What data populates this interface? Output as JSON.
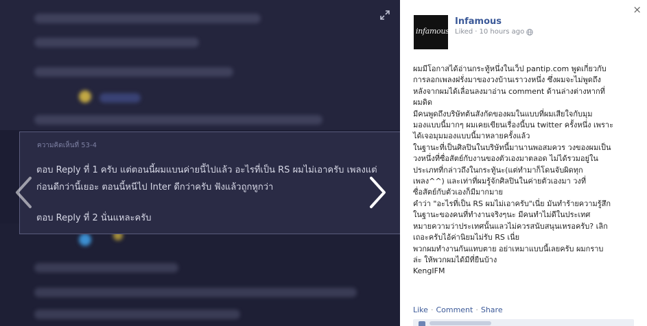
{
  "photo": {
    "card": {
      "header": "ความคิดเห็นที่ 53-4",
      "line1": "ตอบ Reply ที่ 1 ครับ แต่ตอนนี้ผมแบนค่ายนี้ไปแล้ว อะไรที่เป็น RS ผมไม่เอาครับ เพลงแต่",
      "line2": "ก่อนดีกว่านี้เยอะ ตอนนี้หนีไป Inter ดีกว่าครับ ฟังแล้วถูกหูกว่า",
      "line3": "ตอบ Reply ที่ 2 นั่นแหละครับ"
    },
    "prev_icon": "chevron-left-icon",
    "next_icon": "chevron-right-icon",
    "expand_icon": "expand-icon"
  },
  "panel": {
    "close_label": "×",
    "avatar_text": "infamous",
    "page_name": "Infamous",
    "liked": "Liked",
    "time": "10 hours ago",
    "post_lines": [
      "ผมมีโอกาสได้อ่านกระทู้หนึ่งในเว็ป pantip.com พูดเกี่ยวกับ",
      "การลอกเพลงฝรั่งมาของวงบ้านเราวงหนึ่ง ซึ่งผมจะไม่พูดถึง",
      "หลังจากผมได้เลื่อนลงมาอ่าน comment ด้านล่างต่างหากที่",
      "ผมดิด",
      "มีคนพูดถึงบริษัทต้นสังกัดของผมในแบบที่ผมเสียใจกับมุม",
      "มองแบบนี้มากๆ ผมเคยเขียนเรื่องนี้บน twitter ครั้งหนึ่ง เพราะ",
      "ได้เจอมุมมองแบบนี้มาหลายครั้งแล้ว",
      "ในฐานะที่เป็นศิลปินในบริษัทนี้มานานพอสมควร วงของผมเป็น",
      "วงหนึ่งที่ซื่อสัตย์กับงานของตัวเองมาตลอด ไม่ได้รวมอยู่ใน",
      "ประเภทที่กล่าวถึงในกระทู้นะ(แต่ทำมาก็โดนจับผิดทุก",
      "เพลง^^) และเท่าที่ผมรู้จักศิลปินในค่ายตัวเองมา วงที่",
      "ซื่อสัตย์กับตัวเองก็มีมากมาย",
      "คำว่า \"อะไรที่เป็น RS ผมไม่เอาครับ\"เนี่ย มันทำร้ายความรู้สึก",
      "ในฐานะของคนที่ทำงานจริงๆนะ มีคนทำไม่ดีในประเทศ",
      "หมายความว่าประเทศนั้นแลวไม่ควรสนับสนุนเหรอครับ? เลิก",
      "เถอะครับไอ้ค่านิยมไม่รับ RS เนี่ย",
      "พวกผมทำงานกันแทบตาย อย่าเหมาแบบนี้เลยครับ ผมกราบ",
      "ล่ะ ให้พวกผมได้มีที่ยืนบ้าง",
      "KengIFM"
    ],
    "actions": {
      "like": "Like",
      "comment": "Comment",
      "share": "Share"
    }
  },
  "colors": {
    "link": "#3b5998",
    "stage_bg": "#1c1d33",
    "card_bg": "#2a2b45"
  }
}
